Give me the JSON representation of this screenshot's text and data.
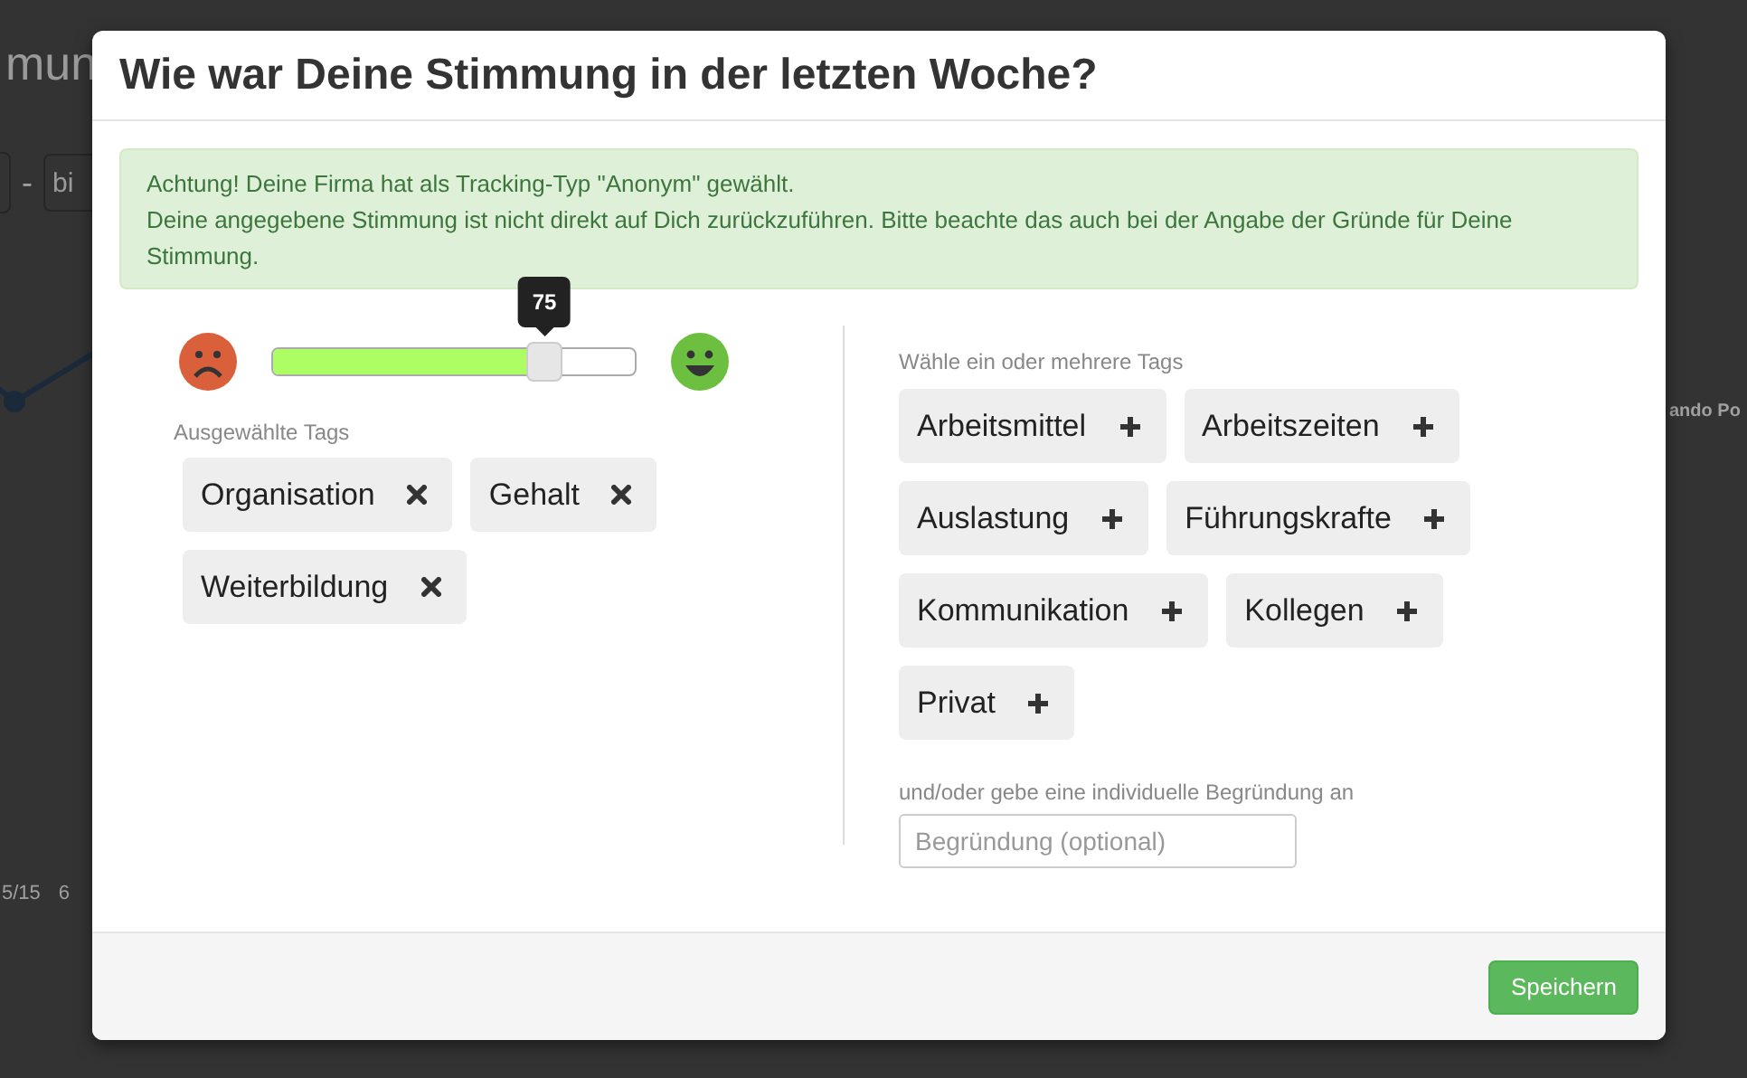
{
  "background": {
    "title": "mun",
    "filter_separator": "-",
    "filter_field": {
      "placeholder": "bi"
    },
    "chart_label": "ando Po",
    "axis_labels": [
      "5/15",
      "6"
    ]
  },
  "dialog": {
    "title": "Wie war Deine Stimmung in der letzten Woche?",
    "alert": {
      "lines": [
        "Achtung! Deine Firma hat als Tracking-Typ \"Anonym\" gewählt.",
        "Deine angegebene Stimmung ist nicht direkt auf Dich zurückzuführen. Bitte beachte das auch bei der Angabe der Gründe für Deine Stimmung."
      ]
    },
    "mood": {
      "level": 0.75,
      "value": "75"
    },
    "selected_tags": {
      "label": "Ausgewählte Tags",
      "tags": [
        "Organisation",
        "Gehalt",
        "Weiterbildung"
      ]
    },
    "available_tags": {
      "label": "Wähle ein oder mehrere Tags",
      "tags": [
        "Arbeitsmittel",
        "Arbeitszeiten",
        "Auslastung",
        "Führungskrafte",
        "Kommunikation",
        "Kollegen",
        "Privat"
      ]
    },
    "reason": {
      "label": "und/oder gebe eine individuelle Begründung an",
      "placeholder": "Begründung (optional)"
    },
    "save_button": "Speichern"
  }
}
